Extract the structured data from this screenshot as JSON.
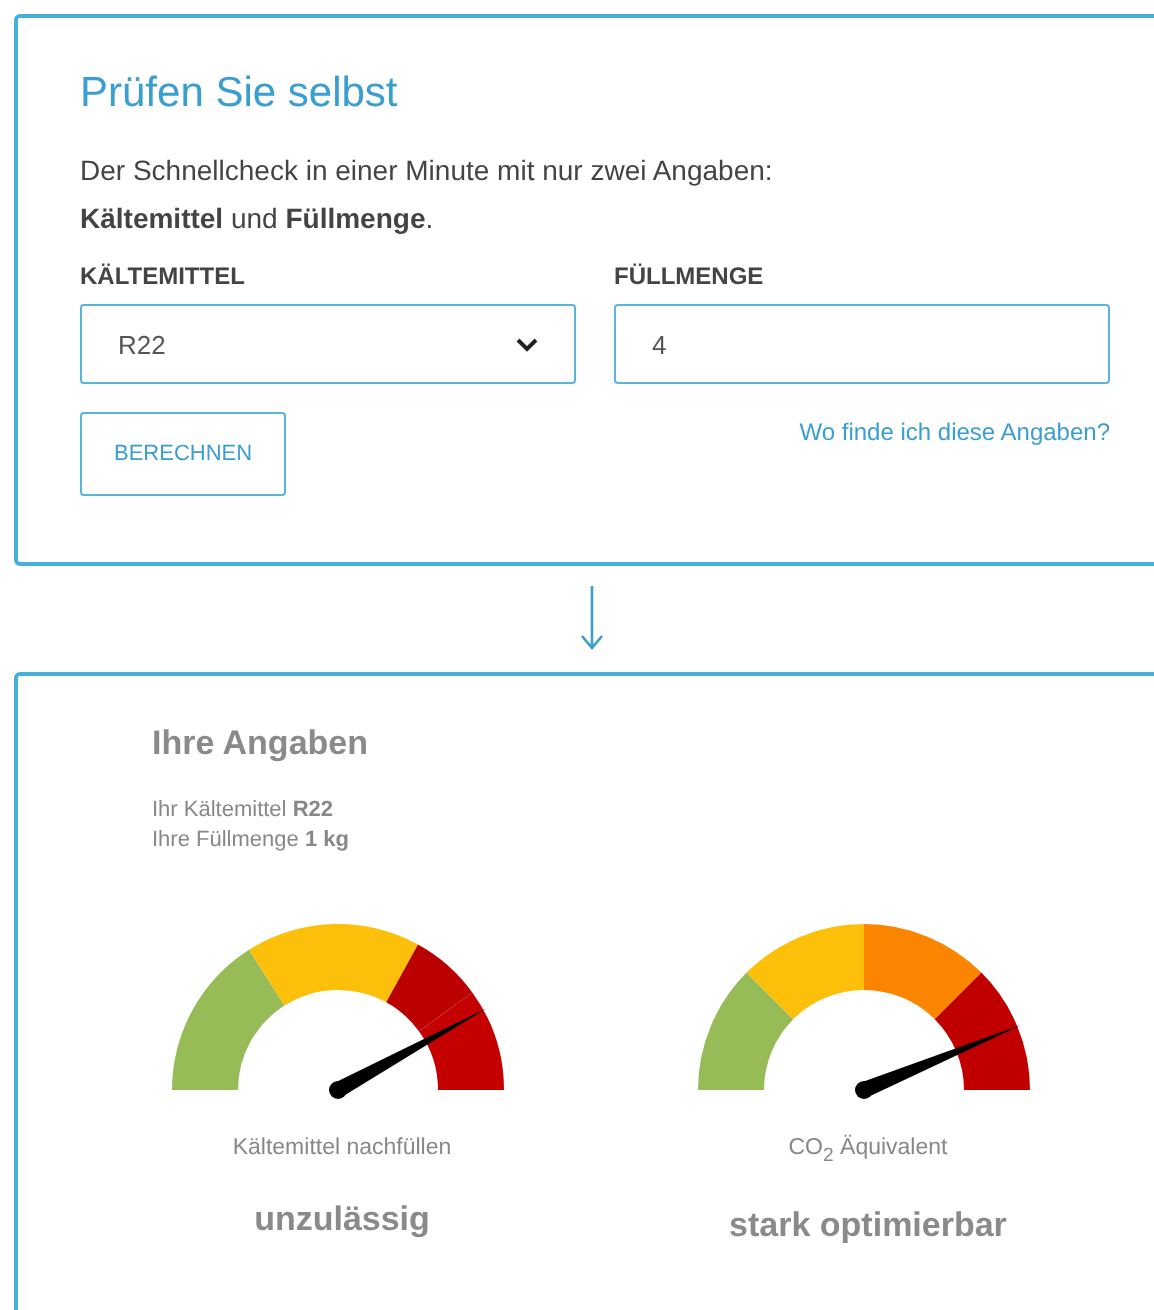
{
  "check": {
    "title": "Prüfen Sie selbst",
    "intro": "Der Schnellcheck in einer Minute mit nur zwei Angaben:",
    "intro_bold": "**Kältemittel** und **Füllmenge**.",
    "refrigerant": {
      "label": "KÄLTEMITTEL",
      "value": "R22"
    },
    "amount": {
      "label": "FÜLLMENGE",
      "value": "4"
    },
    "button": "BERECHNEN",
    "help_link": "Wo finde ich diese Angaben?"
  },
  "result": {
    "title": "Ihre Angaben",
    "lines": [
      "Ihr Kältemittel **R22**",
      "Ihre Füllmenge **1 kg**"
    ],
    "gauges": [
      {
        "kind": "three_zone",
        "level": 0.84,
        "label": "Kältemittel nachfüllen",
        "verdict": "unzulässig"
      },
      {
        "kind": "four_zone",
        "level": 0.875,
        "label": "CO$_{2}$ Äquivalent",
        "verdict": "stark optimierbar"
      }
    ]
  }
}
